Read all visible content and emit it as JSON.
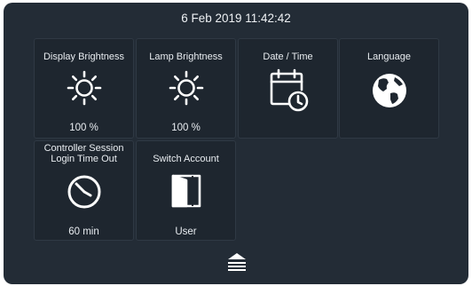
{
  "header": {
    "datetime": "6 Feb 2019 11:42:42"
  },
  "tiles": {
    "display_brightness": {
      "label": "Display Brightness",
      "value": "100 %",
      "icon": "sun-icon"
    },
    "lamp_brightness": {
      "label": "Lamp Brightness",
      "value": "100 %",
      "icon": "sun-icon"
    },
    "date_time": {
      "label": "Date / Time",
      "icon": "calendar-clock-icon"
    },
    "language": {
      "label": "Language",
      "icon": "globe-icon"
    },
    "session_timeout": {
      "label_line1": "Controller Session",
      "label_line2": "Login Time Out",
      "value": "60 min",
      "icon": "timer-icon"
    },
    "switch_account": {
      "label": "Switch Account",
      "value": "User",
      "icon": "door-icon"
    }
  },
  "footer": {
    "icon": "eject-icon"
  },
  "colors": {
    "background": "#232c36",
    "tile": "#1e262f",
    "text": "#e9edf1"
  }
}
